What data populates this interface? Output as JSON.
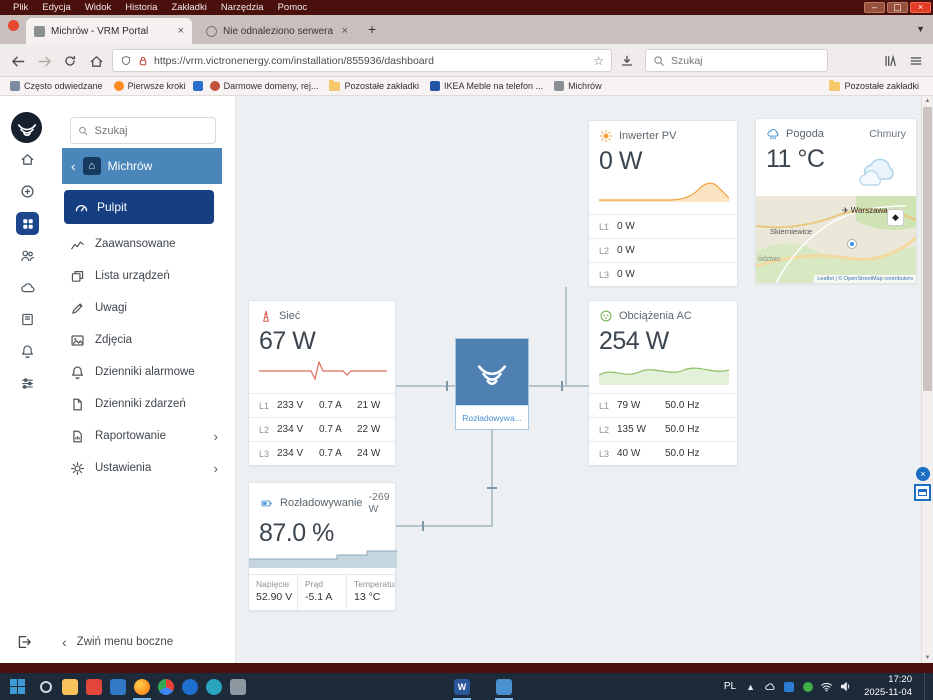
{
  "titlebar": {
    "menu": [
      "Plik",
      "Edycja",
      "Widok",
      "Historia",
      "Zakładki",
      "Narzędzia",
      "Pomoc"
    ]
  },
  "tabs": {
    "active_title": "Michrów - VRM Portal",
    "inactive_title": "Nie odnaleziono serwera"
  },
  "navbar": {
    "url": "https://vrm.victronenergy.com/installation/855936/dashboard",
    "search_placeholder": "Szukaj"
  },
  "bookmarks": {
    "items": [
      {
        "label": "Często odwiedzane"
      },
      {
        "label": "Pierwsze kroki"
      },
      {
        "label": "Darmowe domeny, rej..."
      },
      {
        "label": "Pozostałe zakładki"
      },
      {
        "label": "IKEA Meble na telefon ..."
      },
      {
        "label": "Michrów"
      }
    ],
    "other": "Pozostałe zakładki"
  },
  "sidebar": {
    "search_placeholder": "Szukaj",
    "installation": "Michrów",
    "items": [
      {
        "label": "Pulpit"
      },
      {
        "label": "Zaawansowane"
      },
      {
        "label": "Lista urządzeń"
      },
      {
        "label": "Uwagi"
      },
      {
        "label": "Zdjęcia"
      },
      {
        "label": "Dzienniki alarmowe"
      },
      {
        "label": "Dzienniki zdarzeń"
      },
      {
        "label": "Raportowanie"
      },
      {
        "label": "Ustawienia"
      }
    ],
    "collapse": "Zwiń menu boczne"
  },
  "dashboard": {
    "pv": {
      "title": "Inwerter PV",
      "value": "0 W",
      "rows": [
        {
          "phase": "L1",
          "power": "0 W"
        },
        {
          "phase": "L2",
          "power": "0 W"
        },
        {
          "phase": "L3",
          "power": "0 W"
        }
      ]
    },
    "weather": {
      "title": "Pogoda",
      "condition": "Chmury",
      "temperature": "11 °C",
      "city_main": "Warszawa",
      "city_secondary": "Skierniewice",
      "region_fragment": "ództwo",
      "attribution": "Leaflet | © OpenStreetMap contributors"
    },
    "grid": {
      "title": "Sieć",
      "value": "67 W",
      "rows": [
        {
          "phase": "L1",
          "voltage": "233 V",
          "current": "0.7 A",
          "power": "21 W"
        },
        {
          "phase": "L2",
          "voltage": "234 V",
          "current": "0.7 A",
          "power": "22 W"
        },
        {
          "phase": "L3",
          "voltage": "234 V",
          "current": "0.7 A",
          "power": "24 W"
        }
      ]
    },
    "loads": {
      "title": "Obciążenia AC",
      "value": "254 W",
      "rows": [
        {
          "phase": "L1",
          "power": "79 W",
          "frequency": "50.0 Hz"
        },
        {
          "phase": "L2",
          "power": "135 W",
          "frequency": "50.0 Hz"
        },
        {
          "phase": "L3",
          "power": "40 W",
          "frequency": "50.0 Hz"
        }
      ]
    },
    "battery": {
      "title": "Rozładowywanie",
      "power": "-269 W",
      "soc": "87.0 %",
      "stats": [
        {
          "label": "Napięcie",
          "value": "52.90 V"
        },
        {
          "label": "Prąd",
          "value": "-5.1 A"
        },
        {
          "label": "Temperatura",
          "value": "13 °C"
        }
      ]
    },
    "node": {
      "label": "Rozładowywa..."
    }
  },
  "taskbar": {
    "lang": "PL",
    "time": "17:20",
    "date": "2025-11-04"
  },
  "colors": {
    "vrm_blue": "#153f82",
    "highlight_blue": "#4b86bb",
    "pv_orange": "#f2a13c",
    "grid_red": "#d95f54",
    "loads_green": "#6fae4e",
    "battery_blue": "#4a90d2"
  }
}
